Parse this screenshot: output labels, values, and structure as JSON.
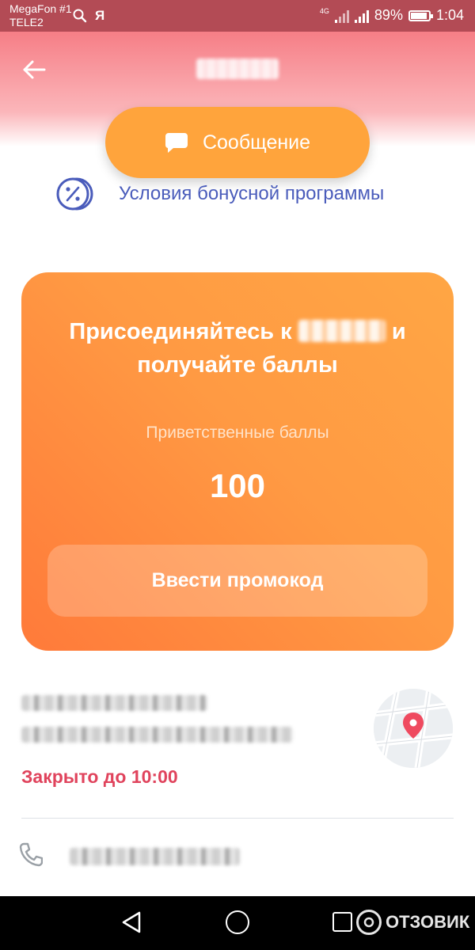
{
  "status_bar": {
    "carrier1": "MegaFon #1",
    "carrier2": "TELE2",
    "net_type": "4G",
    "battery": "89%",
    "battery_level": 0.89,
    "time": "1:04",
    "icons": [
      "search-icon",
      "yandex-icon",
      "signal-icon",
      "battery-icon"
    ]
  },
  "header": {
    "back_icon": "arrow-left-icon"
  },
  "actions": {
    "message_label": "Сообщение",
    "message_icon": "chat-bubble-icon",
    "bonus_conditions_label": "Условия бонусной программы",
    "bonus_icon": "percent-coin-icon"
  },
  "promo": {
    "title_part1": "Присоединяйтесь к",
    "title_part2": "и",
    "title_line2": "получайте баллы",
    "welcome_label": "Приветственные баллы",
    "welcome_value": "100",
    "promo_button": "Ввести промокод"
  },
  "location": {
    "status": "Закрыто до 10:00",
    "map_icon": "location-pin-icon"
  },
  "contact": {
    "phone_icon": "phone-icon"
  },
  "nav_bar": {
    "watermark": "ОТЗОВИК"
  },
  "colors": {
    "accent_orange": "#ffa43c",
    "link_blue": "#4a5cbb",
    "closed_red": "#e0435c",
    "header_pink": "#f67e86"
  }
}
